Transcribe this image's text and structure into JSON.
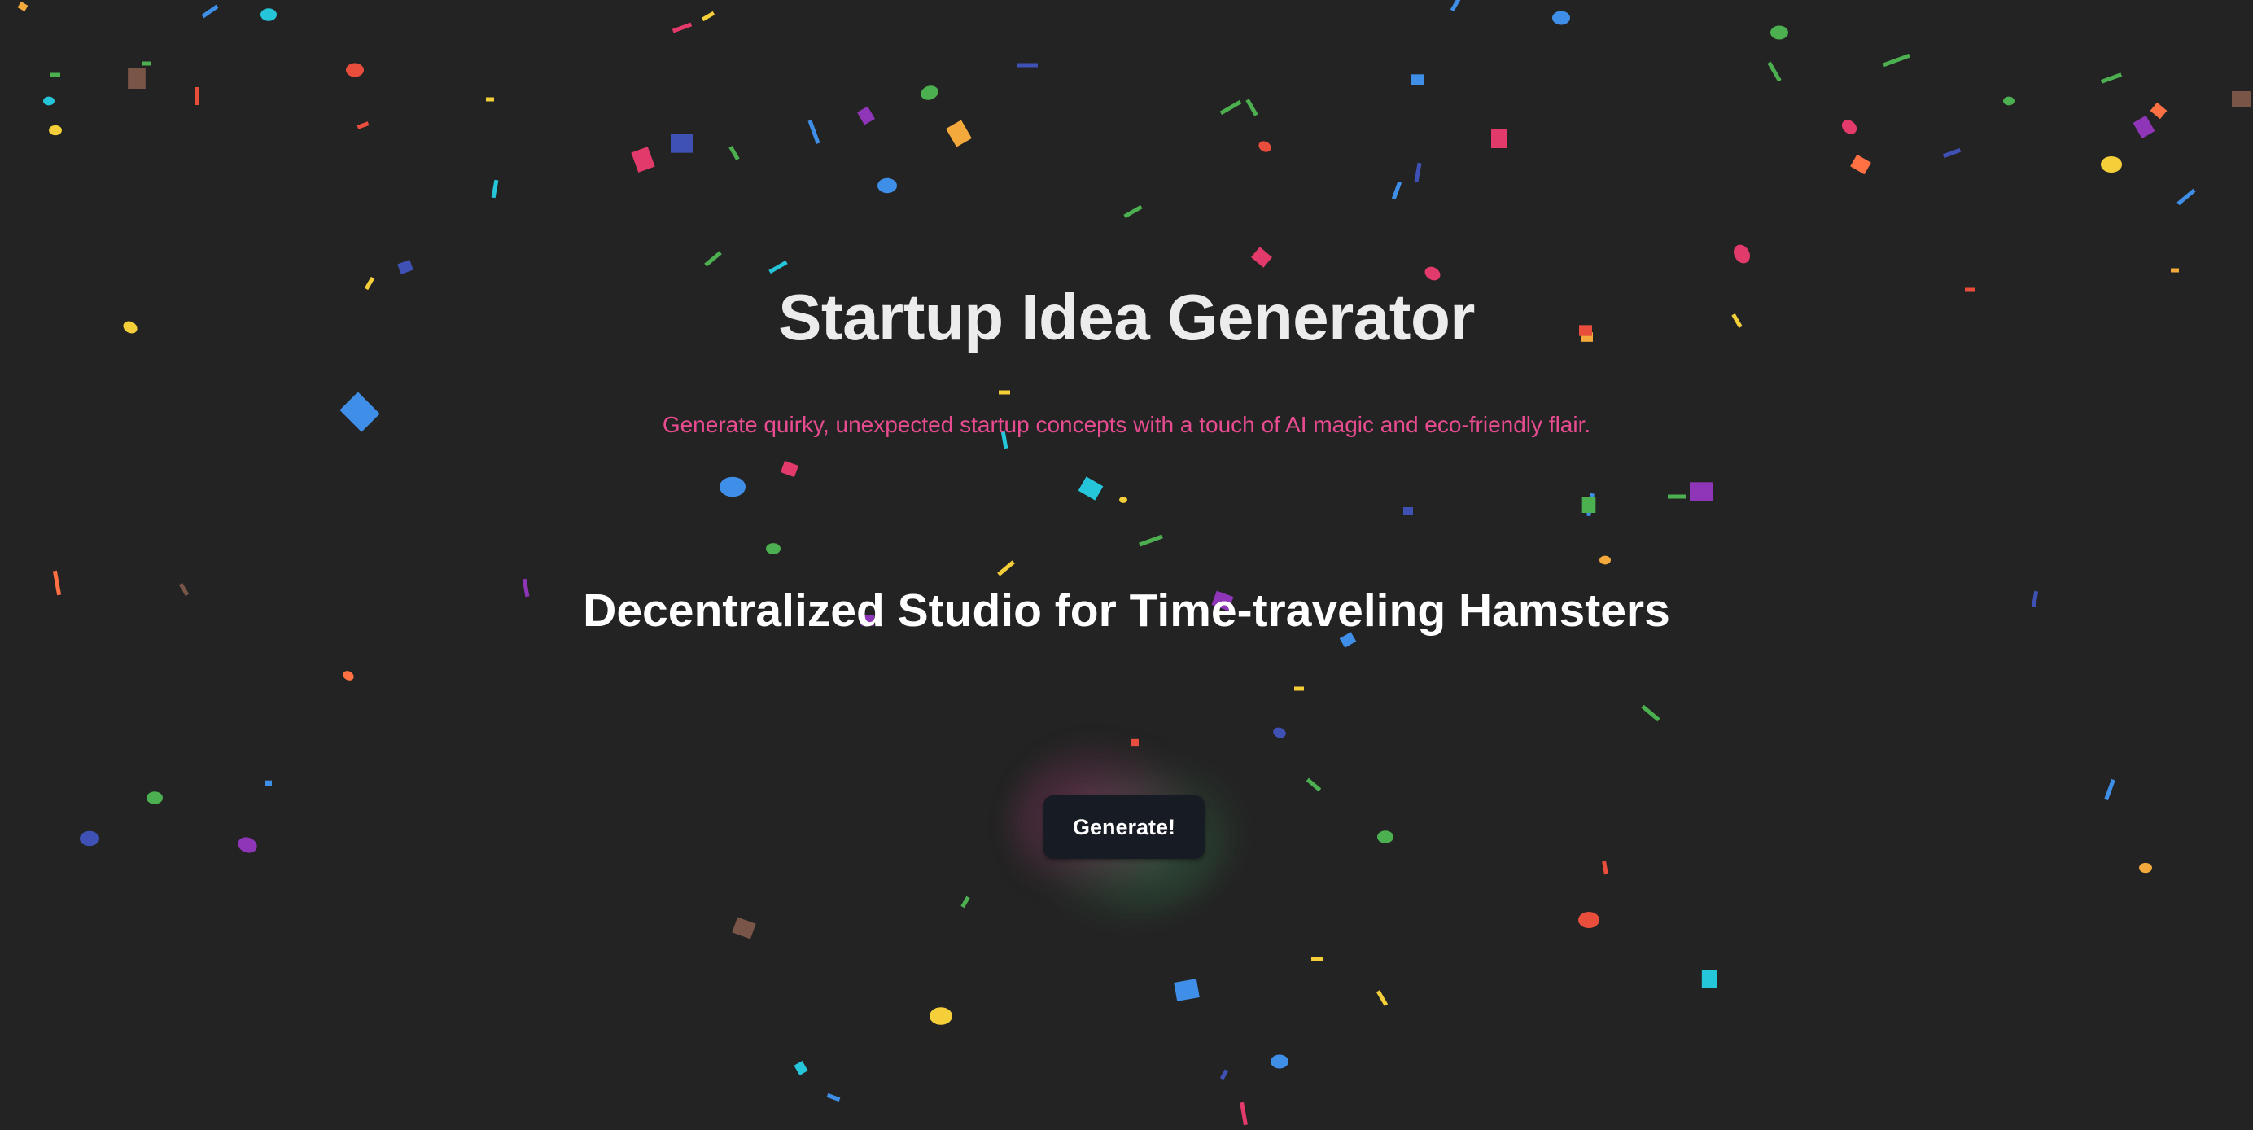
{
  "app": {
    "title": "Startup Idea Generator",
    "subtitle": "Generate quirky, unexpected startup concepts with a touch of AI magic and eco-friendly flair."
  },
  "idea": {
    "text": "Decentralized Studio for Time-traveling Hamsters"
  },
  "actions": {
    "generate_label": "Generate!"
  },
  "theme": {
    "background": "#232323",
    "title_color": "#ececec",
    "subtitle_color": "#e84c90",
    "idea_color": "#ffffff",
    "button_background": "#171b24"
  },
  "confetti": {
    "palette": [
      "#e94e3c",
      "#f3a93c",
      "#f5cf3a",
      "#8bc34a",
      "#4caf50",
      "#26c6da",
      "#3f8fe8",
      "#3f51b5",
      "#8e35b8",
      "#e23a6a",
      "#ff7043",
      "#795548"
    ]
  }
}
